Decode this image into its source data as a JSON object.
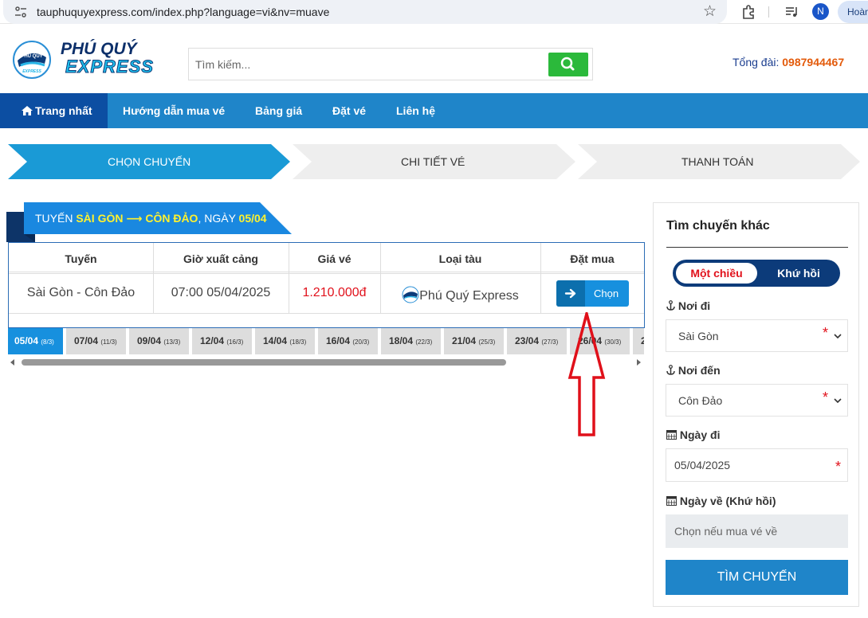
{
  "browser": {
    "url": "tauphuquyexpress.com/index.php?language=vi&nv=muave",
    "avatar_letter": "N",
    "profile_label": "Hoàn"
  },
  "header": {
    "logo_line1": "PHÚ QUÝ",
    "logo_line2": "EXPRESS",
    "search_placeholder": "Tìm kiếm...",
    "hotline_label": "Tổng đài:",
    "hotline_number": "0987944467"
  },
  "nav": {
    "items": [
      {
        "label": "Trang nhất"
      },
      {
        "label": "Hướng dẫn mua vé"
      },
      {
        "label": "Bảng giá"
      },
      {
        "label": "Đặt vé"
      },
      {
        "label": "Liên hệ"
      }
    ]
  },
  "steps": [
    {
      "label": "Chọn chuyến"
    },
    {
      "label": "Chi tiết vé"
    },
    {
      "label": "Thanh toán"
    }
  ],
  "route": {
    "prefix": "TUYẾN",
    "from": "SÀI GÒN",
    "to": "CÔN ĐẢO",
    "date_prefix": ", NGÀY",
    "date": "05/04"
  },
  "table": {
    "headers": [
      "Tuyến",
      "Giờ xuất cảng",
      "Giá vé",
      "Loại tàu",
      "Đặt mua"
    ],
    "row": {
      "route": "Sài Gòn - Côn Đảo",
      "departure": "07:00 05/04/2025",
      "price": "1.210.000đ",
      "vessel": "Phú Quý Express",
      "action": "Chọn"
    }
  },
  "date_tabs": [
    {
      "date": "05/04",
      "lunar": "(8/3)"
    },
    {
      "date": "07/04",
      "lunar": "(11/3)"
    },
    {
      "date": "09/04",
      "lunar": "(13/3)"
    },
    {
      "date": "12/04",
      "lunar": "(16/3)"
    },
    {
      "date": "14/04",
      "lunar": "(18/3)"
    },
    {
      "date": "16/04",
      "lunar": "(20/3)"
    },
    {
      "date": "18/04",
      "lunar": "(22/3)"
    },
    {
      "date": "21/04",
      "lunar": "(25/3)"
    },
    {
      "date": "23/04",
      "lunar": "(27/3)"
    },
    {
      "date": "26/04",
      "lunar": "(30/3)"
    },
    {
      "date": "2",
      "lunar": ""
    }
  ],
  "sidebar": {
    "title": "Tìm chuyến khác",
    "one_way": "Một chiều",
    "round_trip": "Khứ hồi",
    "from_label": "Nơi đi",
    "from_value": "Sài Gòn",
    "to_label": "Nơi đến",
    "to_value": "Côn Đảo",
    "depart_label": "Ngày đi",
    "depart_value": "05/04/2025",
    "return_label": "Ngày về (Khứ hồi)",
    "return_placeholder": "Chọn nếu mua vé về",
    "required_mark": "*",
    "search_button": "TÌM CHUYẾN"
  },
  "colors": {
    "nav_bg": "#1f85c9",
    "nav_active": "#0c4ea2",
    "price_red": "#e1121c",
    "highlight_yellow": "#fff22e",
    "hotline_orange": "#e35a0a"
  }
}
